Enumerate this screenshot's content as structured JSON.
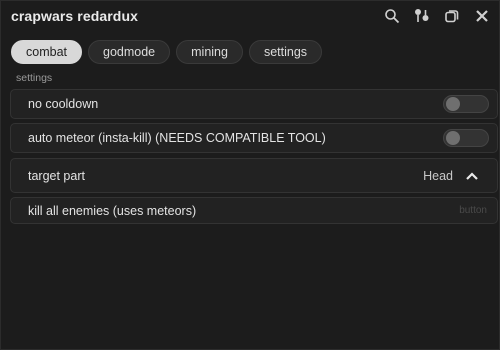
{
  "window": {
    "title": "crapwars redardux"
  },
  "title_icons": [
    "search-icon",
    "pin-icon",
    "restore-icon",
    "close-icon"
  ],
  "tabs": [
    {
      "label": "combat",
      "active": true
    },
    {
      "label": "godmode",
      "active": false
    },
    {
      "label": "mining",
      "active": false
    },
    {
      "label": "settings",
      "active": false
    }
  ],
  "section": {
    "label": "settings"
  },
  "rows": {
    "no_cooldown": {
      "label": "no cooldown",
      "enabled": false
    },
    "auto_meteor": {
      "label": "auto meteor (insta-kill) (NEEDS COMPATIBLE TOOL)",
      "enabled": false
    },
    "target_part": {
      "label": "target part",
      "value": "Head"
    },
    "kill_all": {
      "label": "kill all enemies (uses meteors)",
      "hint": "button"
    }
  },
  "colors": {
    "background": "#1c1c1c",
    "row": "#222222",
    "active_tab": "#d8d8d8"
  }
}
